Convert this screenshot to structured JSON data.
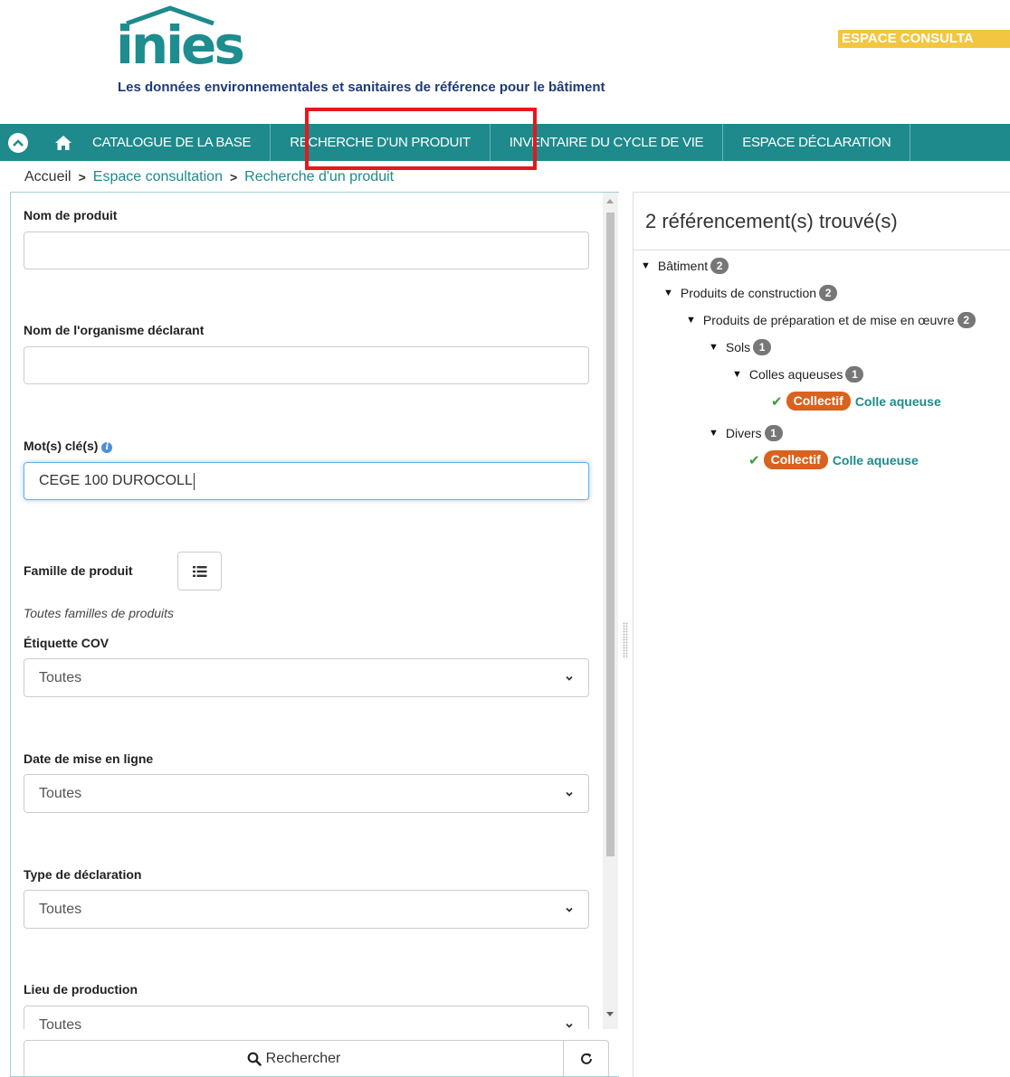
{
  "header": {
    "logo_text": "inies",
    "tagline": "Les données environnementales et sanitaires de référence pour le bâtiment",
    "espace_badge": "ESPACE CONSULTA"
  },
  "nav": {
    "items": [
      {
        "label": "CATALOGUE DE LA BASE"
      },
      {
        "label": "RECHERCHE D'UN PRODUIT"
      },
      {
        "label": "INVENTAIRE DU CYCLE DE VIE"
      },
      {
        "label": "ESPACE DÉCLARATION"
      }
    ]
  },
  "breadcrumb": {
    "home": "Accueil",
    "items": [
      "Espace consultation",
      "Recherche d'un produit"
    ],
    "separator": ">"
  },
  "form": {
    "product_name": {
      "label": "Nom de produit",
      "value": ""
    },
    "organism": {
      "label": "Nom de l'organisme déclarant",
      "value": ""
    },
    "keywords": {
      "label": "Mot(s) clé(s)",
      "value": "CEGE 100 DUROCOLL"
    },
    "family": {
      "label": "Famille de produit",
      "hint": "Toutes familles de produits"
    },
    "cov_label": {
      "label": "Étiquette COV",
      "value": "Toutes"
    },
    "online_date": {
      "label": "Date de mise en ligne",
      "value": "Toutes"
    },
    "decl_type": {
      "label": "Type de déclaration",
      "value": "Toutes"
    },
    "production_place": {
      "label": "Lieu de production",
      "value": "Toutes"
    },
    "search_label": "Rechercher"
  },
  "results": {
    "title": "2 référencement(s) trouvé(s)",
    "tree": [
      {
        "label": "Bâtiment",
        "count": "2"
      },
      {
        "label": "Produits de construction",
        "count": "2"
      },
      {
        "label": "Produits de préparation et de mise en œuvre",
        "count": "2"
      },
      {
        "label": "Sols",
        "count": "1"
      },
      {
        "label": "Colles aqueuses",
        "count": "1"
      },
      {
        "label": "Divers",
        "count": "1"
      }
    ],
    "leaves": [
      {
        "tag": "Collectif",
        "name": "Colle aqueuse"
      },
      {
        "tag": "Collectif",
        "name": "Colle aqueuse"
      }
    ]
  },
  "colors": {
    "brand": "#1e8a8c",
    "tagline": "#1f3a78",
    "badge": "#f3c640",
    "collectif": "#d9621f",
    "highlight": "#e8161d"
  }
}
